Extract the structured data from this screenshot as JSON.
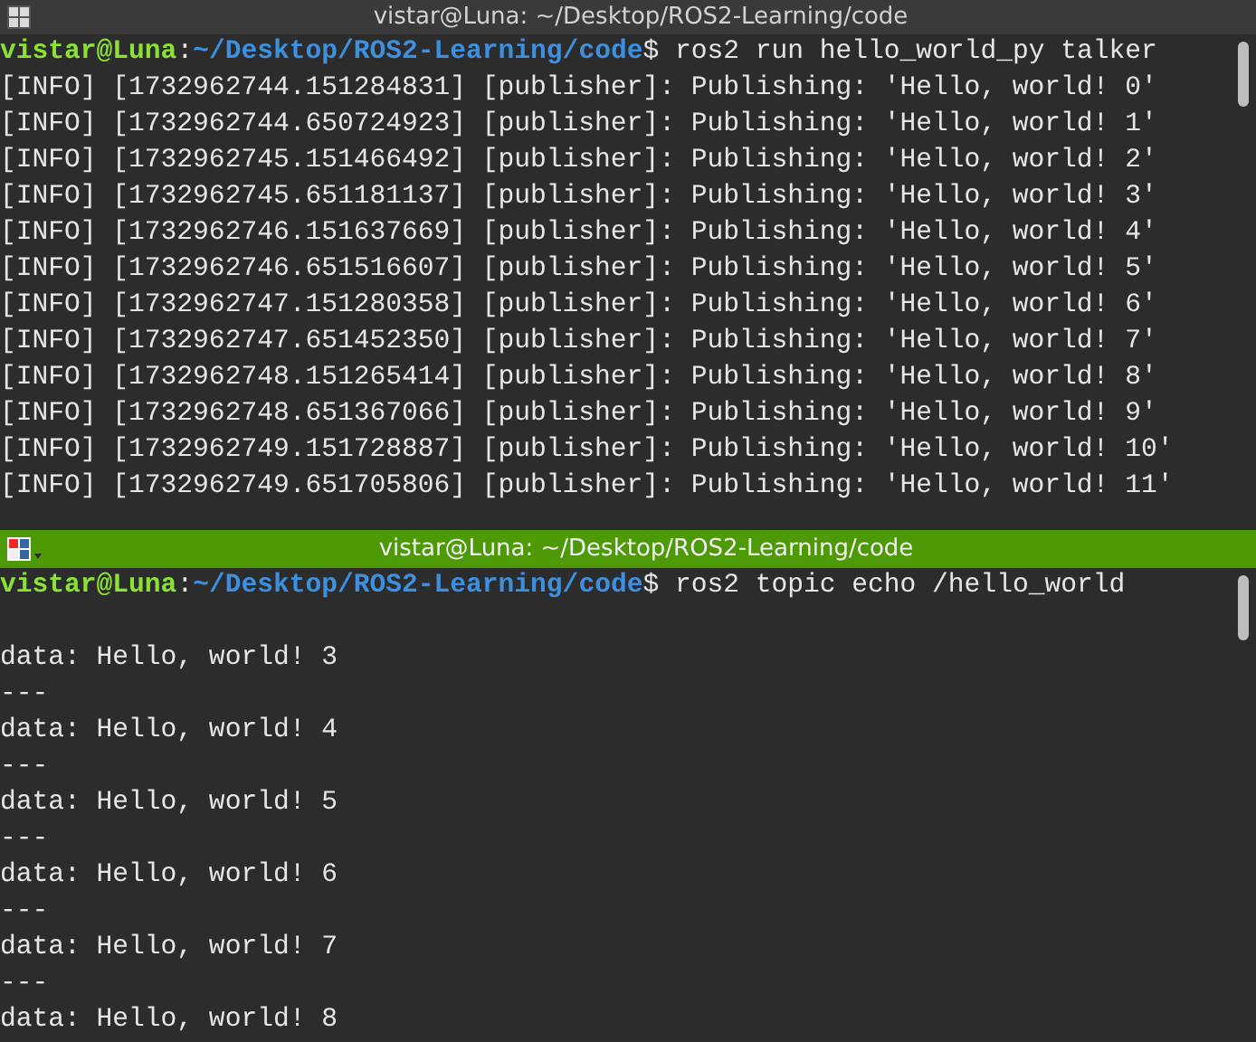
{
  "panes": [
    {
      "title": "vistar@Luna: ~/Desktop/ROS2-Learning/code",
      "active": false,
      "lines": [
        {
          "kind": "prompt",
          "segments": [
            {
              "kind": "user",
              "text": "vistar@Luna"
            },
            {
              "kind": "plain",
              "text": ":"
            },
            {
              "kind": "path",
              "text": "~/Desktop/ROS2-Learning/code"
            },
            {
              "kind": "plain",
              "text": "$ ros2 run hello_world_py talker"
            }
          ]
        },
        {
          "kind": "output",
          "text": "[INFO] [1732962744.151284831] [publisher]: Publishing: 'Hello, world! 0'"
        },
        {
          "kind": "output",
          "text": "[INFO] [1732962744.650724923] [publisher]: Publishing: 'Hello, world! 1'"
        },
        {
          "kind": "output",
          "text": "[INFO] [1732962745.151466492] [publisher]: Publishing: 'Hello, world! 2'"
        },
        {
          "kind": "output",
          "text": "[INFO] [1732962745.651181137] [publisher]: Publishing: 'Hello, world! 3'"
        },
        {
          "kind": "output",
          "text": "[INFO] [1732962746.151637669] [publisher]: Publishing: 'Hello, world! 4'"
        },
        {
          "kind": "output",
          "text": "[INFO] [1732962746.651516607] [publisher]: Publishing: 'Hello, world! 5'"
        },
        {
          "kind": "output",
          "text": "[INFO] [1732962747.151280358] [publisher]: Publishing: 'Hello, world! 6'"
        },
        {
          "kind": "output",
          "text": "[INFO] [1732962747.651452350] [publisher]: Publishing: 'Hello, world! 7'"
        },
        {
          "kind": "output",
          "text": "[INFO] [1732962748.151265414] [publisher]: Publishing: 'Hello, world! 8'"
        },
        {
          "kind": "output",
          "text": "[INFO] [1732962748.651367066] [publisher]: Publishing: 'Hello, world! 9'"
        },
        {
          "kind": "output",
          "text": "[INFO] [1732962749.151728887] [publisher]: Publishing: 'Hello, world! 10'"
        },
        {
          "kind": "output",
          "text": "[INFO] [1732962749.651705806] [publisher]: Publishing: 'Hello, world! 11'"
        }
      ]
    },
    {
      "title": "vistar@Luna: ~/Desktop/ROS2-Learning/code",
      "active": true,
      "lines": [
        {
          "kind": "prompt",
          "segments": [
            {
              "kind": "user",
              "text": "vistar@Luna"
            },
            {
              "kind": "plain",
              "text": ":"
            },
            {
              "kind": "path",
              "text": "~/Desktop/ROS2-Learning/code"
            },
            {
              "kind": "plain",
              "text": "$ ros2 topic echo /hello_world"
            }
          ]
        },
        {
          "kind": "blank"
        },
        {
          "kind": "output",
          "text": "data: Hello, world! 3"
        },
        {
          "kind": "output",
          "text": "---"
        },
        {
          "kind": "output",
          "text": "data: Hello, world! 4"
        },
        {
          "kind": "output",
          "text": "---"
        },
        {
          "kind": "output",
          "text": "data: Hello, world! 5"
        },
        {
          "kind": "output",
          "text": "---"
        },
        {
          "kind": "output",
          "text": "data: Hello, world! 6"
        },
        {
          "kind": "output",
          "text": "---"
        },
        {
          "kind": "output",
          "text": "data: Hello, world! 7"
        },
        {
          "kind": "output",
          "text": "---"
        },
        {
          "kind": "output",
          "text": "data: Hello, world! 8"
        }
      ]
    }
  ]
}
